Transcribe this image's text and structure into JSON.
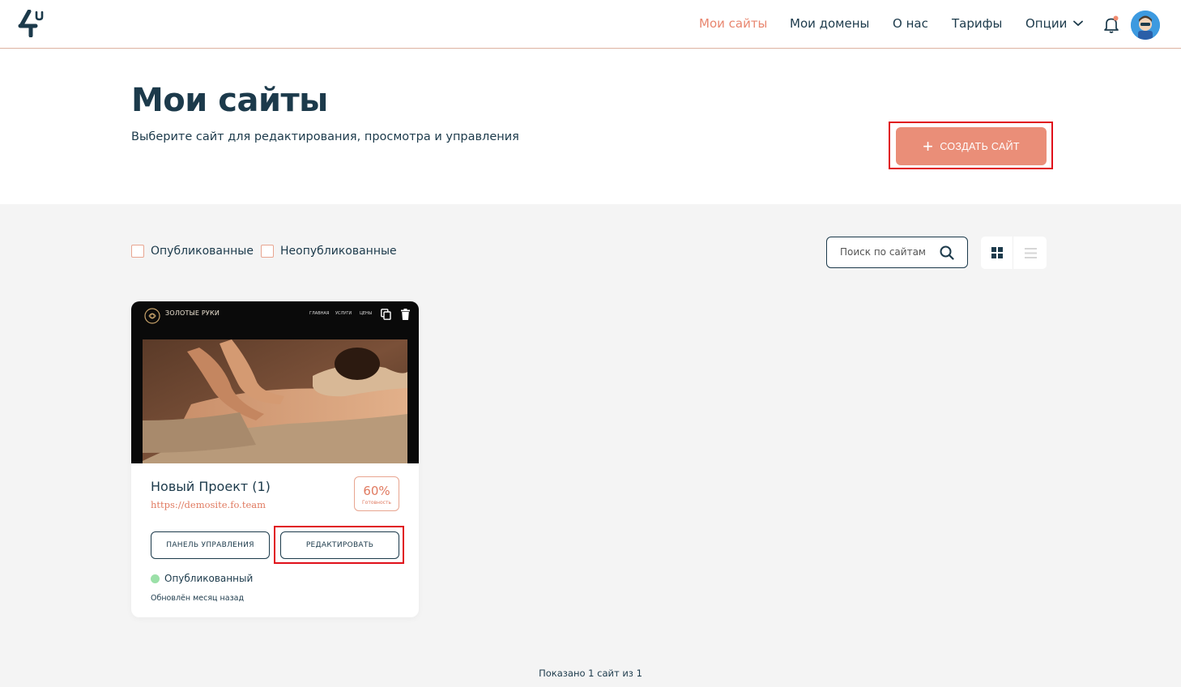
{
  "header": {
    "nav": [
      {
        "label": "Мои сайты",
        "active": true
      },
      {
        "label": "Мои домены",
        "active": false
      },
      {
        "label": "О нас",
        "active": false
      },
      {
        "label": "Тарифы",
        "active": false
      },
      {
        "label": "Опции",
        "active": false
      }
    ],
    "notification_badge_color": "#f08a6e"
  },
  "hero": {
    "title": "Мои сайты",
    "subtitle": "Выберите сайт для редактирования, просмотра и управления",
    "create_button": "СОЗДАТЬ САЙТ"
  },
  "filters": {
    "published": "Опубликованные",
    "unpublished": "Неопубликованные",
    "search_placeholder": "Поиск по сайтам",
    "view_mode": "grid"
  },
  "sites": [
    {
      "preview": {
        "brand": "ЗОЛОТЫЕ РУКИ",
        "menu": [
          "ГЛАВНАЯ",
          "УСЛУГИ",
          "ЦЕНЫ"
        ]
      },
      "name": "Новый Проект (1)",
      "url": "https://demosite.fo.team",
      "progress": {
        "value": "60%",
        "label": "Готовность"
      },
      "dashboard_button": "ПАНЕЛЬ УПРАВЛЕНИЯ",
      "edit_button": "РЕДАКТИРОВАТЬ",
      "status": "Опубликованный",
      "updated": "Обновлён месяц назад"
    }
  ],
  "footer": {
    "count_text": "Показано 1 сайт из 1"
  },
  "colors": {
    "accent": "#ea8e78",
    "primary_text": "#1c3a4b",
    "published_dot": "#9be0a8",
    "highlight_frame": "#e0101a"
  }
}
